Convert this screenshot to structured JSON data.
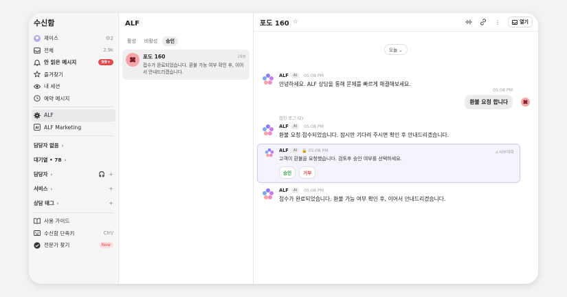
{
  "sidebar": {
    "title": "수신함",
    "user": {
      "name": "제이스",
      "count": "2"
    },
    "items": [
      {
        "label": "전체",
        "count": "2.9k",
        "icon": "inbox-icon"
      },
      {
        "label": "안 읽은 메시지",
        "badge": "99+",
        "icon": "bell-icon"
      },
      {
        "label": "즐겨찾기",
        "icon": "star-icon"
      },
      {
        "label": "내 세션",
        "icon": "eye-icon"
      },
      {
        "label": "예약 메시지",
        "icon": "clock-icon"
      }
    ],
    "channels": [
      {
        "label": "ALF",
        "icon": "gear-icon"
      },
      {
        "label": "ALF Marketing",
        "icon": "ai-box-icon"
      }
    ],
    "groups": [
      {
        "label": "담당자 없음"
      },
      {
        "label": "대기열 • 78"
      },
      {
        "label": "담당자"
      },
      {
        "label": "서비스"
      },
      {
        "label": "상담 태그"
      }
    ],
    "footer": [
      {
        "label": "사용 가이드",
        "icon": "book-icon"
      },
      {
        "label": "수신함 단축키",
        "shortcut": "Ctrl/",
        "icon": "keyboard-icon"
      },
      {
        "label": "전문가 찾기",
        "badge": "New",
        "icon": "verified-icon"
      }
    ]
  },
  "list": {
    "title": "ALF",
    "tabs": [
      "활성",
      "비활성",
      "승인"
    ],
    "active_tab": "승인",
    "conversation": {
      "name": "포도 160",
      "time": "19분",
      "preview": "접수가 완료되었습니다. 환불 가능 여부 확인 후, 이어서 안내드리겠습니다."
    }
  },
  "chat": {
    "title": "포도 160",
    "open_label": "열기",
    "day": "오늘",
    "bot_name": "ALF",
    "ai_tag": "AI",
    "messages": [
      {
        "time": "05:08 PM",
        "text": "안녕하세요. ALF 상담을 통해 문제를 빠르게 해결해보세요."
      },
      {
        "time": "05:08 PM",
        "text": "환불 요청 접수되었습니다. 잠시만 기다려 주시면 확인 후 안내드리겠습니다."
      },
      {
        "time": "05:08 PM",
        "text": "접수가 완료되었습니다. 환불 가능 여부 확인 후, 이어서 안내드리겠습니다."
      }
    ],
    "user_message": {
      "time": "05:08 PM",
      "text": "환불 요청 합니다"
    },
    "folded_log": "접힌 로그 (2)",
    "approval": {
      "time": "05:08 PM",
      "internal_label": "내부대화",
      "text": "고객이 환불을 요청했습니다. 검토후 승인 여부를 선택하세요.",
      "approve_label": "승인",
      "reject_label": "거부"
    }
  }
}
